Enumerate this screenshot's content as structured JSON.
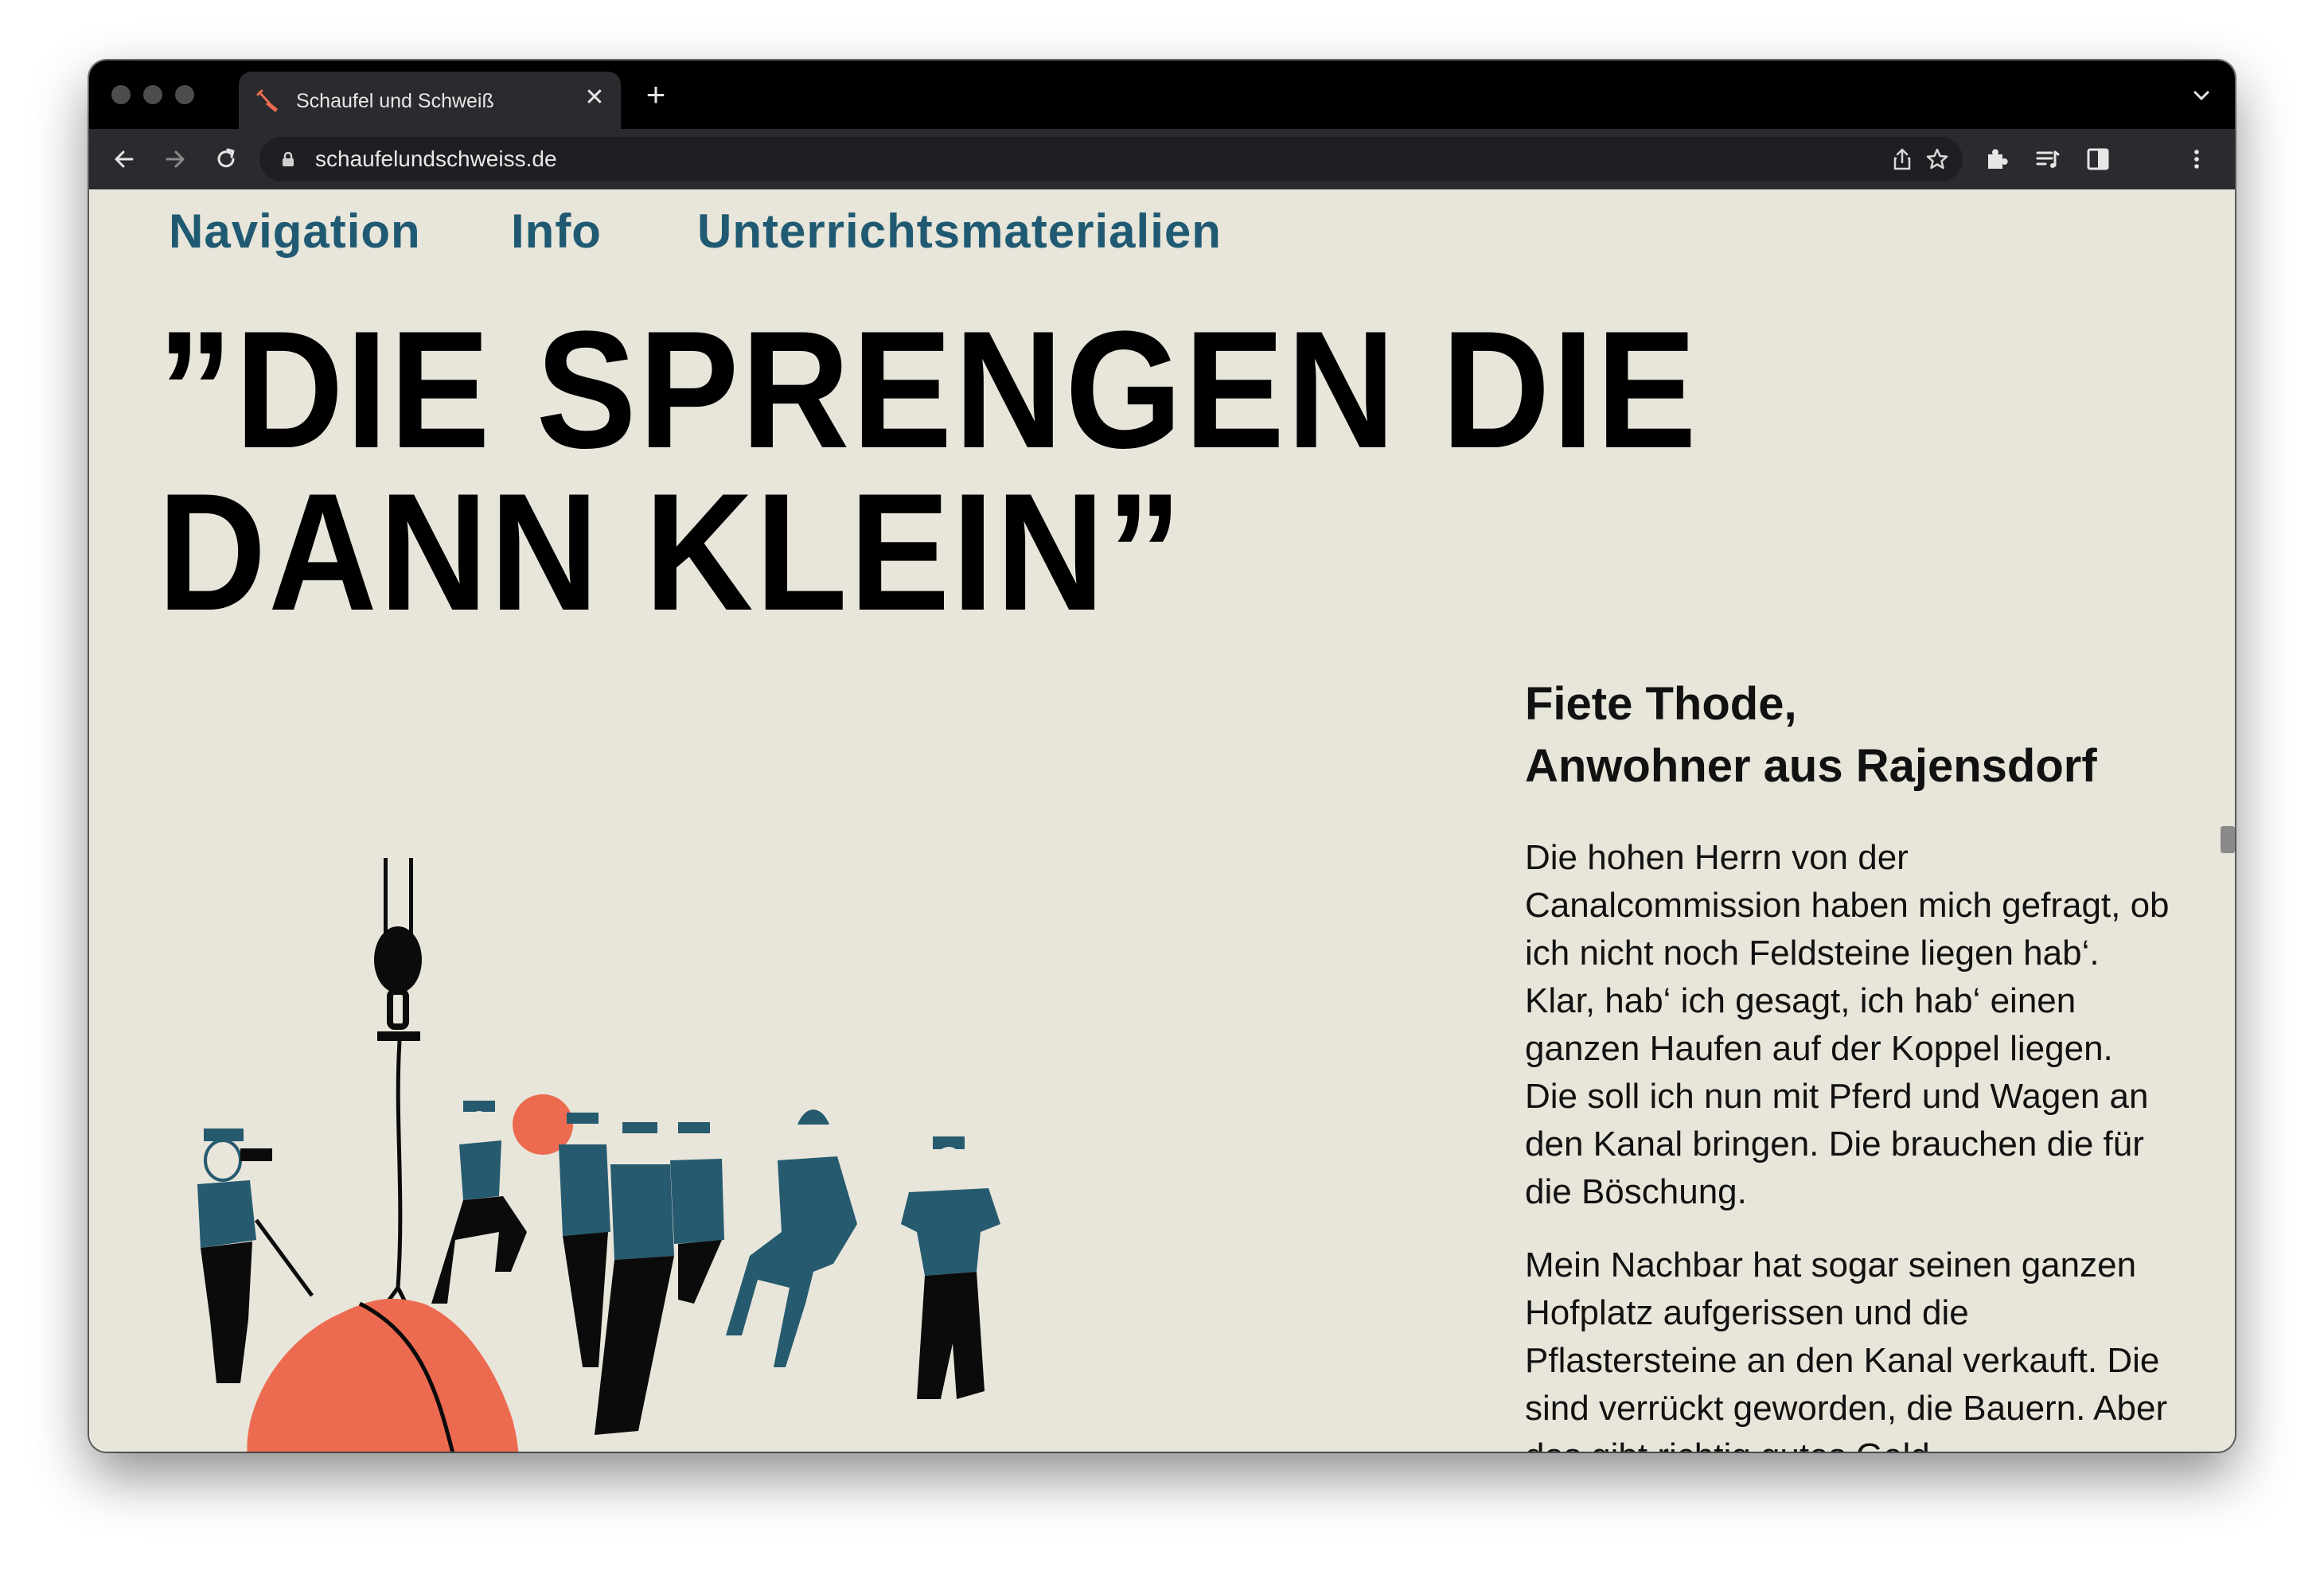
{
  "browser": {
    "tab_title": "Schaufel und Schweiß",
    "url": "schaufelundschweiss.de",
    "new_tab_icon": "plus",
    "close_icon": "x"
  },
  "nav": {
    "items": [
      {
        "label": "Navigation"
      },
      {
        "label": "Info"
      },
      {
        "label": "Unterrichtsmaterialien"
      }
    ]
  },
  "page": {
    "headline": "”DIE SPRENGEN DIE DANN KLEIN”",
    "speaker_name": "Fiete Thode,",
    "speaker_role": "Anwohner aus Rajensdorf",
    "paragraphs": [
      "Die hohen Herrn von der Canalcommission haben mich gefragt, ob ich nicht noch Feldsteine liegen hab‘. Klar, hab‘ ich gesagt, ich hab‘ einen ganzen Haufen auf der Koppel liegen. Die soll ich nun mit Pferd und Wagen an den Kanal bringen. Die brauchen die für die Böschung.",
      "Mein Nachbar hat sogar seinen ganzen Hofplatz aufgerissen und die Pflastersteine an den Kanal verkauft. Die sind verrückt geworden, die Bauern. Aber das gibt richtig gutes Geld."
    ]
  },
  "colors": {
    "background": "#e8e5da",
    "nav_blue": "#1f5a72",
    "figure_blue": "#255a6f",
    "stone_red": "#ec6b50",
    "black": "#0b0b0b"
  }
}
